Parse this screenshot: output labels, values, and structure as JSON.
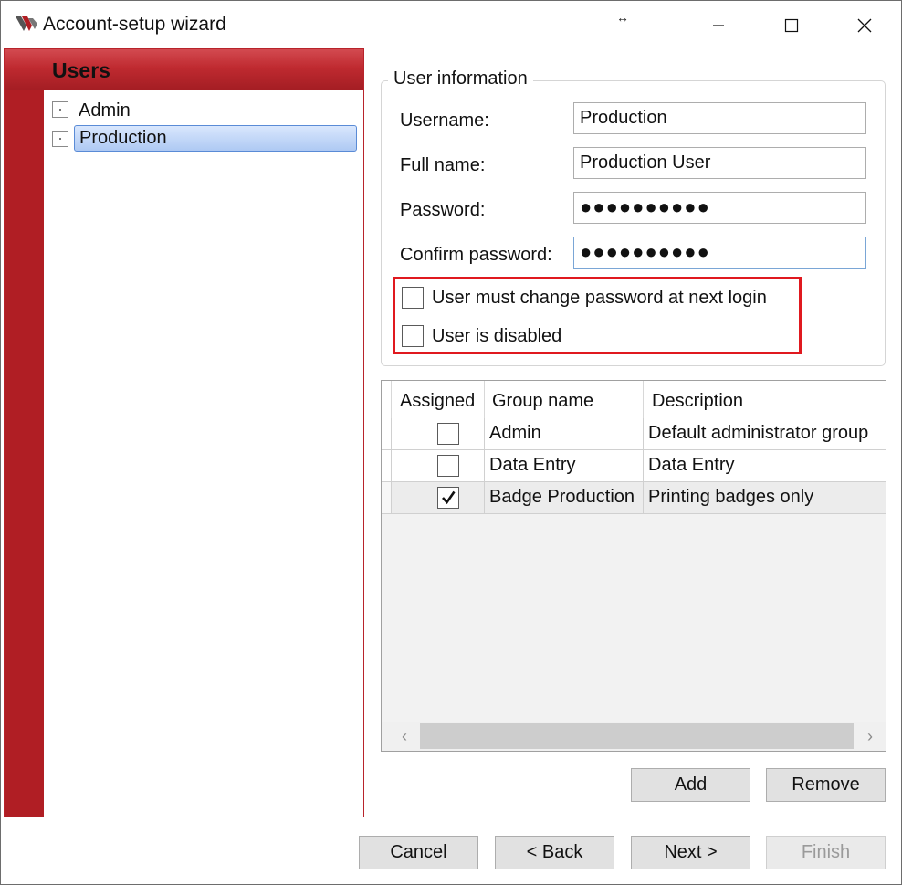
{
  "window": {
    "title": "Account-setup wizard",
    "resize_glyph": "↔"
  },
  "users": {
    "header": "Users",
    "items": [
      {
        "label": "Admin"
      },
      {
        "label": "Production",
        "selected": true
      }
    ]
  },
  "user_info": {
    "group_title": "User information",
    "username_label": "Username:",
    "username_value": "Production",
    "fullname_label": "Full name:",
    "fullname_value": "Production User",
    "password_label": "Password:",
    "password_value": "●●●●●●●●●●",
    "confirm_label": "Confirm password:",
    "confirm_value": "●●●●●●●●●●",
    "must_change_label": "User must change password at next login",
    "must_change_checked": false,
    "disabled_label": "User is disabled",
    "disabled_checked": false
  },
  "groups": {
    "columns": [
      "Assigned",
      "Group name",
      "Description"
    ],
    "rows": [
      {
        "assigned": false,
        "name": "Admin",
        "description": "Default administrator group"
      },
      {
        "assigned": false,
        "name": "Data Entry",
        "description": "Data Entry"
      },
      {
        "assigned": true,
        "name": "Badge Production",
        "description": "Printing badges only"
      }
    ]
  },
  "buttons": {
    "add": "Add",
    "remove": "Remove",
    "cancel": "Cancel",
    "back": "< Back",
    "next": "Next >",
    "finish": "Finish"
  },
  "colors": {
    "accent_red": "#b01e24",
    "highlight_red": "#e0191f",
    "selection_blue": "#aec9f3"
  }
}
